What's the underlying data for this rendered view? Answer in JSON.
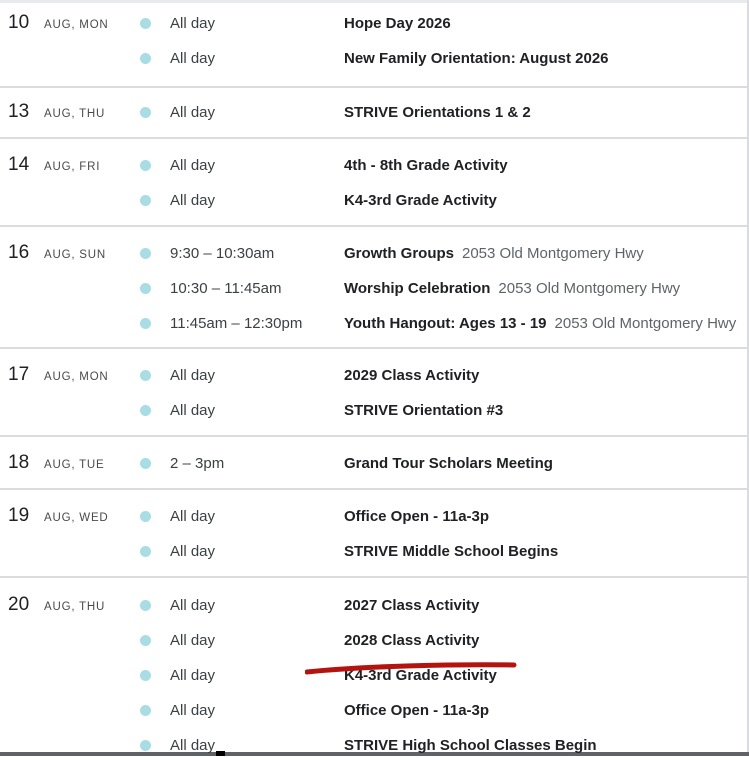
{
  "days": [
    {
      "num": "10",
      "label": "AUG, MON",
      "events": [
        {
          "time": "All day",
          "title": "Hope Day 2026",
          "location": ""
        },
        {
          "time": "All day",
          "title": "New Family Orientation: August 2026",
          "location": ""
        }
      ]
    },
    {
      "num": "13",
      "label": "AUG, THU",
      "events": [
        {
          "time": "All day",
          "title": "STRIVE Orientations 1 & 2",
          "location": ""
        }
      ]
    },
    {
      "num": "14",
      "label": "AUG, FRI",
      "events": [
        {
          "time": "All day",
          "title": "4th - 8th Grade Activity",
          "location": ""
        },
        {
          "time": "All day",
          "title": "K4-3rd Grade Activity",
          "location": ""
        }
      ]
    },
    {
      "num": "16",
      "label": "AUG, SUN",
      "events": [
        {
          "time": "9:30 – 10:30am",
          "title": "Growth Groups",
          "location": "2053 Old Montgomery Hwy"
        },
        {
          "time": "10:30 – 11:45am",
          "title": "Worship Celebration",
          "location": "2053 Old Montgomery Hwy"
        },
        {
          "time": "11:45am – 12:30pm",
          "title": "Youth Hangout: Ages 13 - 19",
          "location": "2053 Old Montgomery Hwy"
        }
      ]
    },
    {
      "num": "17",
      "label": "AUG, MON",
      "events": [
        {
          "time": "All day",
          "title": "2029 Class Activity",
          "location": ""
        },
        {
          "time": "All day",
          "title": "STRIVE Orientation #3",
          "location": ""
        }
      ]
    },
    {
      "num": "18",
      "label": "AUG, TUE",
      "events": [
        {
          "time": "2 – 3pm",
          "title": "Grand Tour Scholars Meeting",
          "location": ""
        }
      ]
    },
    {
      "num": "19",
      "label": "AUG, WED",
      "events": [
        {
          "time": "All day",
          "title": "Office Open - 11a-3p",
          "location": ""
        },
        {
          "time": "All day",
          "title": "STRIVE Middle School Begins",
          "location": ""
        }
      ]
    },
    {
      "num": "20",
      "label": "AUG, THU",
      "events": [
        {
          "time": "All day",
          "title": "2027 Class Activity",
          "location": ""
        },
        {
          "time": "All day",
          "title": "2028 Class Activity",
          "location": ""
        },
        {
          "time": "All day",
          "title": "K4-3rd Grade Activity",
          "location": ""
        },
        {
          "time": "All day",
          "title": "Office Open - 11a-3p",
          "location": ""
        },
        {
          "time": "All day",
          "title": "STRIVE High School Classes Begin",
          "location": ""
        }
      ]
    }
  ],
  "colors": {
    "event_dot": "#a8dde3",
    "annotation_stroke": "#b3140f",
    "divider": "#dadce0"
  }
}
